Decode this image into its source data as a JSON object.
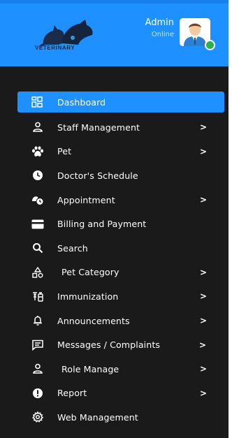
{
  "header": {
    "logo_text": "VETERINARY",
    "user_name": "Admin",
    "user_status": "Online"
  },
  "colors": {
    "header_bg": "#1e90ff",
    "sidebar_bg": "#1a1a1a",
    "active_bg": "#1e90ff",
    "online": "#27b24a"
  },
  "menu": [
    {
      "label": "Dashboard",
      "icon": "dashboard-grid-icon",
      "active": true,
      "has_submenu": false
    },
    {
      "label": "Staff Management",
      "icon": "person-icon",
      "has_submenu": true
    },
    {
      "label": "Pet",
      "icon": "paw-icon",
      "has_submenu": true
    },
    {
      "label": "Doctor's Schedule",
      "icon": "clock-icon",
      "has_submenu": false
    },
    {
      "label": "Appointment",
      "icon": "appointment-clock-icon",
      "has_submenu": true
    },
    {
      "label": "Billing and Payment",
      "icon": "credit-card-icon",
      "has_submenu": false
    },
    {
      "label": "Search",
      "icon": "search-icon",
      "has_submenu": false
    },
    {
      "label": "Pet Category",
      "icon": "category-shapes-icon",
      "has_submenu": true
    },
    {
      "label": "Immunization",
      "icon": "vaccine-icon",
      "has_submenu": true
    },
    {
      "label": "Announcements",
      "icon": "bell-icon",
      "has_submenu": true
    },
    {
      "label": "Messages / Complaints",
      "icon": "message-icon",
      "has_submenu": true
    },
    {
      "label": "Role Manage",
      "icon": "person-icon",
      "has_submenu": true
    },
    {
      "label": "Report",
      "icon": "alert-circle-icon",
      "has_submenu": true
    },
    {
      "label": "Web Management",
      "icon": "gear-icon",
      "has_submenu": false
    }
  ],
  "chevron": ">"
}
